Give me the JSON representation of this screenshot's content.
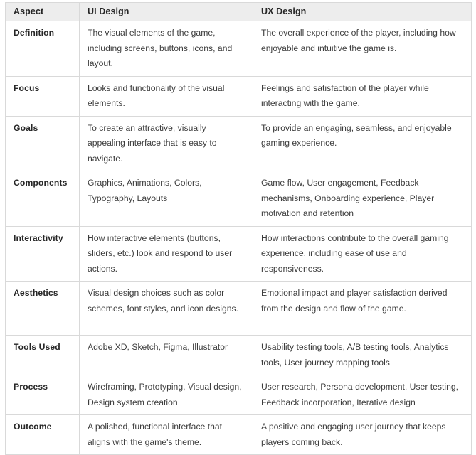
{
  "table": {
    "columns": [
      "Aspect",
      "UI Design",
      "UX Design"
    ],
    "rows": [
      {
        "aspect": "Definition",
        "ui": "The visual elements of the game, including screens, buttons, icons, and layout.",
        "ux": "The overall experience of the player, including how enjoyable and intuitive the game is."
      },
      {
        "aspect": "Focus",
        "ui": "Looks and functionality of the visual elements.",
        "ux": "Feelings and satisfaction of the player while interacting with the game."
      },
      {
        "aspect": "Goals",
        "ui": "To create an attractive, visually appealing interface that is easy to navigate.",
        "ux": "To provide an engaging, seamless, and enjoyable gaming experience."
      },
      {
        "aspect": "Components",
        "ui": "Graphics, Animations, Colors, Typography, Layouts",
        "ux": "Game flow, User engagement, Feedback mechanisms, Onboarding experience, Player motivation and retention"
      },
      {
        "aspect": "Interactivity",
        "ui": "How interactive elements (buttons, sliders, etc.) look and respond to user actions.",
        "ux": "How interactions contribute to the overall gaming experience, including ease of use and responsiveness."
      },
      {
        "aspect": "Aesthetics",
        "ui": "Visual design choices such as color schemes, font styles, and icon designs.",
        "ux": "Emotional impact and player satisfaction derived from the design and flow of the game."
      },
      {
        "aspect": "Tools Used",
        "ui": "Adobe XD, Sketch, Figma, Illustrator",
        "ux": "Usability testing tools, A/B testing tools, Analytics tools, User journey mapping tools"
      },
      {
        "aspect": "Process",
        "ui": "Wireframing, Prototyping, Visual design, Design system creation",
        "ux": "User research, Persona development, User testing, Feedback incorporation, Iterative design"
      },
      {
        "aspect": "Outcome",
        "ui": "A polished, functional interface that aligns with the game's theme.",
        "ux": "A positive and engaging user journey that keeps players coming back."
      }
    ]
  },
  "colors": {
    "header_background": "#ededed",
    "border": "#d9d9d9",
    "header_text": "#262626",
    "body_text": "#3c3c3c",
    "page_background": "#ffffff"
  }
}
